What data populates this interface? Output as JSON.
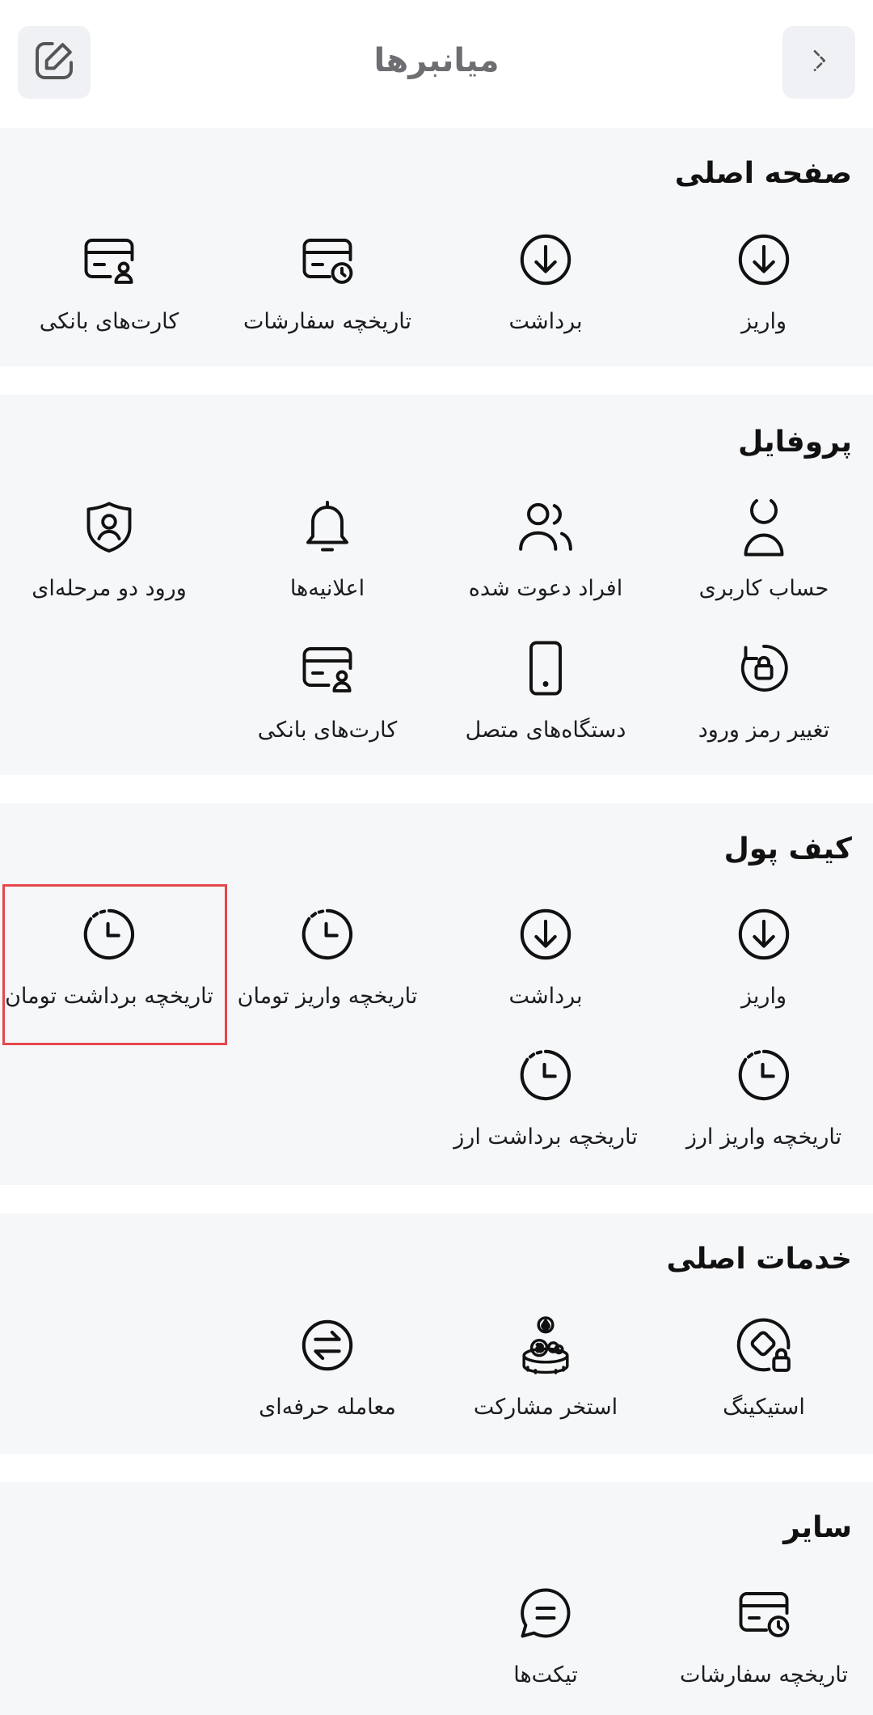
{
  "header": {
    "title": "میانبرها",
    "edit_icon": "edit-square-icon",
    "back_icon": "chevron-right-icon"
  },
  "colors": {
    "section_bg": "#f6f7f9",
    "text": "#1c1c1e",
    "title_gray": "#6d6d72",
    "highlight": "#e5484d"
  },
  "sections": {
    "main_page": {
      "title": "صفحه اصلی",
      "items": [
        {
          "label": "واریز",
          "icon": "deposit-arrow-icon"
        },
        {
          "label": "برداشت",
          "icon": "withdraw-arrow-icon"
        },
        {
          "label": "تاریخچه سفارشات",
          "icon": "card-clock-icon"
        },
        {
          "label": "کارت‌های بانکی",
          "icon": "bank-card-user-icon"
        }
      ]
    },
    "profile": {
      "title": "پروفایل",
      "items": [
        {
          "label": "حساب کاربری",
          "icon": "user-icon"
        },
        {
          "label": "افراد دعوت شده",
          "icon": "users-icon"
        },
        {
          "label": "اعلانیه‌ها",
          "icon": "bell-icon"
        },
        {
          "label": "ورود دو مرحله‌ای",
          "icon": "shield-user-icon"
        },
        {
          "label": "تغییر رمز ورود",
          "icon": "lock-refresh-icon"
        },
        {
          "label": "دستگاه‌های متصل",
          "icon": "phone-icon"
        },
        {
          "label": "کارت‌های بانکی",
          "icon": "bank-card-user-icon"
        }
      ]
    },
    "wallet": {
      "title": "کیف پول",
      "items": [
        {
          "label": "واریز",
          "icon": "deposit-arrow-icon"
        },
        {
          "label": "برداشت",
          "icon": "withdraw-arrow-icon"
        },
        {
          "label": "تاریخچه واریز تومان",
          "icon": "history-clock-icon"
        },
        {
          "label": "تاریخچه برداشت تومان",
          "icon": "history-clock-icon"
        },
        {
          "label": "تاریخچه واریز ارز",
          "icon": "history-clock-icon"
        },
        {
          "label": "تاریخچه برداشت ارز",
          "icon": "history-clock-icon"
        }
      ]
    },
    "services": {
      "title": "خدمات اصلی",
      "items": [
        {
          "label": "استیکینگ",
          "icon": "staking-lock-icon"
        },
        {
          "label": "استخر مشارکت",
          "icon": "crypto-pool-icon"
        },
        {
          "label": "معامله حرفه‌ای",
          "icon": "swap-arrows-icon"
        }
      ]
    },
    "other": {
      "title": "سایر",
      "items": [
        {
          "label": "تاریخچه سفارشات",
          "icon": "card-clock-icon"
        },
        {
          "label": "تیکت‌ها",
          "icon": "chat-ticket-icon"
        }
      ]
    }
  }
}
